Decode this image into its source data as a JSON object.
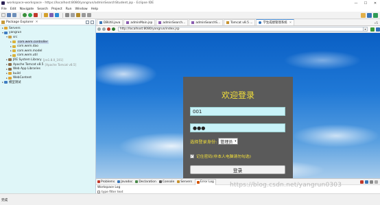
{
  "window": {
    "title": "workspace-workspace - https://localhost:8080/yangrun/adminSearchStudent.jsp - Eclipse IDE",
    "controls": [
      "—",
      "☐",
      "✕"
    ]
  },
  "menu": [
    "File",
    "Edit",
    "Navigate",
    "Search",
    "Project",
    "Run",
    "Window",
    "Help"
  ],
  "explorer": {
    "title": "Package Explorer",
    "close": "✕",
    "nodes": [
      {
        "label": "Servers",
        "note": ""
      },
      {
        "label": "yangrun",
        "note": ""
      },
      {
        "label": "src",
        "note": ""
      },
      {
        "label": "com.wem.controller",
        "note": ""
      },
      {
        "label": "com.wem.dao",
        "note": ""
      },
      {
        "label": "com.wem.model",
        "note": ""
      },
      {
        "label": "com.wem.util",
        "note": ""
      },
      {
        "label": "JRE System Library",
        "note": "[jre1.8.0_191]"
      },
      {
        "label": "Apache Tomcat v8.5",
        "note": "[Apache Tomcat v8.5]"
      },
      {
        "label": "Web App Libraries",
        "note": ""
      },
      {
        "label": "build",
        "note": ""
      },
      {
        "label": "WebContent",
        "note": ""
      },
      {
        "label": "模型测试",
        "note": ""
      }
    ]
  },
  "editor": {
    "tabs": [
      {
        "label": "DBUtil.java"
      },
      {
        "label": "adminMain.jsp"
      },
      {
        "label": "adminSearch..."
      },
      {
        "label": "adminSearchS..."
      },
      {
        "label": "Tomcat v8.5 ..."
      },
      {
        "label": "学生成绩管理系统"
      }
    ],
    "more": "»5",
    "url": "http://localhost:8080/yangrun/index.jsp"
  },
  "login": {
    "title": "欢迎登录",
    "username": "001",
    "password": "●●●",
    "role_label": "选择登录身份:",
    "role_value": "管理员",
    "role_caret": "▾",
    "remember_check": "✓",
    "remember_label": "记住密码(非本人电脑请勿勾选)",
    "submit": "登录"
  },
  "bottom": {
    "tabs": [
      "Problems",
      "Javadoc",
      "Declaration",
      "Console",
      "Servers",
      "Error Log"
    ],
    "log_title": "Workspace Log",
    "filter_text": "type filter text"
  },
  "status": {
    "text": "完成"
  },
  "watermark": "https://blog.csdn.net/yangrun0303"
}
